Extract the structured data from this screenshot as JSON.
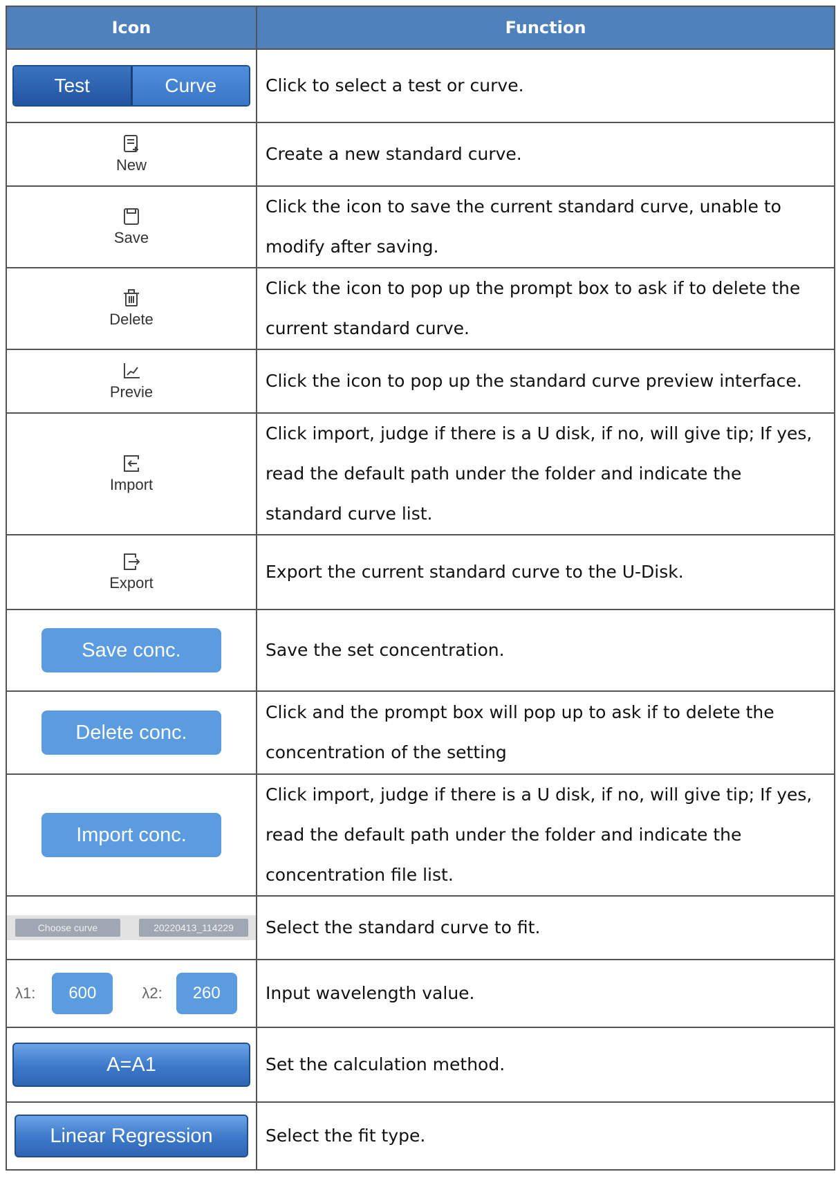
{
  "header": {
    "icon": "Icon",
    "function": "Function"
  },
  "rows": [
    {
      "kind": "segmented",
      "seg_left": "Test",
      "seg_right": "Curve",
      "text": [
        "Click to select a test or curve."
      ]
    },
    {
      "kind": "toolbar",
      "icon": "new-document-icon",
      "label": "New",
      "text": [
        "Create a new standard curve."
      ]
    },
    {
      "kind": "toolbar",
      "icon": "save-icon",
      "label": "Save",
      "text": [
        "Click the icon to save the current standard curve, unable to",
        "modify after saving."
      ]
    },
    {
      "kind": "toolbar",
      "icon": "trash-icon",
      "label": "Delete",
      "text": [
        "Click the icon to pop up the prompt box to ask if to delete the",
        "current standard curve."
      ]
    },
    {
      "kind": "toolbar",
      "icon": "chart-preview-icon",
      "label": "Previe",
      "text": [
        "Click the icon to pop up the standard curve preview interface."
      ]
    },
    {
      "kind": "toolbar",
      "icon": "import-icon",
      "label": "Import",
      "text": [
        "Click import, judge if there is a U disk, if no, will give tip; If yes,",
        "read the default path under the folder and indicate the",
        "standard curve list."
      ]
    },
    {
      "kind": "toolbar",
      "icon": "export-icon",
      "label": "Export",
      "text": [
        "Export the current standard curve to the U-Disk."
      ]
    },
    {
      "kind": "button",
      "label": "Save conc.",
      "text": [
        "Save the set concentration."
      ]
    },
    {
      "kind": "button",
      "label": "Delete conc.",
      "text": [
        "Click and the prompt box will pop up to ask if to delete the",
        "concentration of the setting"
      ]
    },
    {
      "kind": "button",
      "label": "Import conc.",
      "text": [
        "Click import, judge if there is a U disk, if no, will give tip; If yes,",
        "read the default path under the folder and indicate the",
        "concentration file list."
      ]
    },
    {
      "kind": "curvebar",
      "choose_label": "Choose curve",
      "curve_value": "20220413_114229",
      "text": [
        "Select the standard curve to fit."
      ]
    },
    {
      "kind": "wavelength",
      "l1_label": "λ1:",
      "l1_value": "600",
      "l2_label": "λ2:",
      "l2_value": "260",
      "text": [
        "Input wavelength value."
      ]
    },
    {
      "kind": "glossy",
      "label": "A=A1",
      "text": [
        "Set the calculation method."
      ]
    },
    {
      "kind": "glossy",
      "label": "Linear Regression",
      "text": [
        "Select the fit type."
      ]
    }
  ],
  "colors": {
    "header_bg": "#4f81bd",
    "button_blue": "#5b9be0",
    "border": "#555555"
  }
}
